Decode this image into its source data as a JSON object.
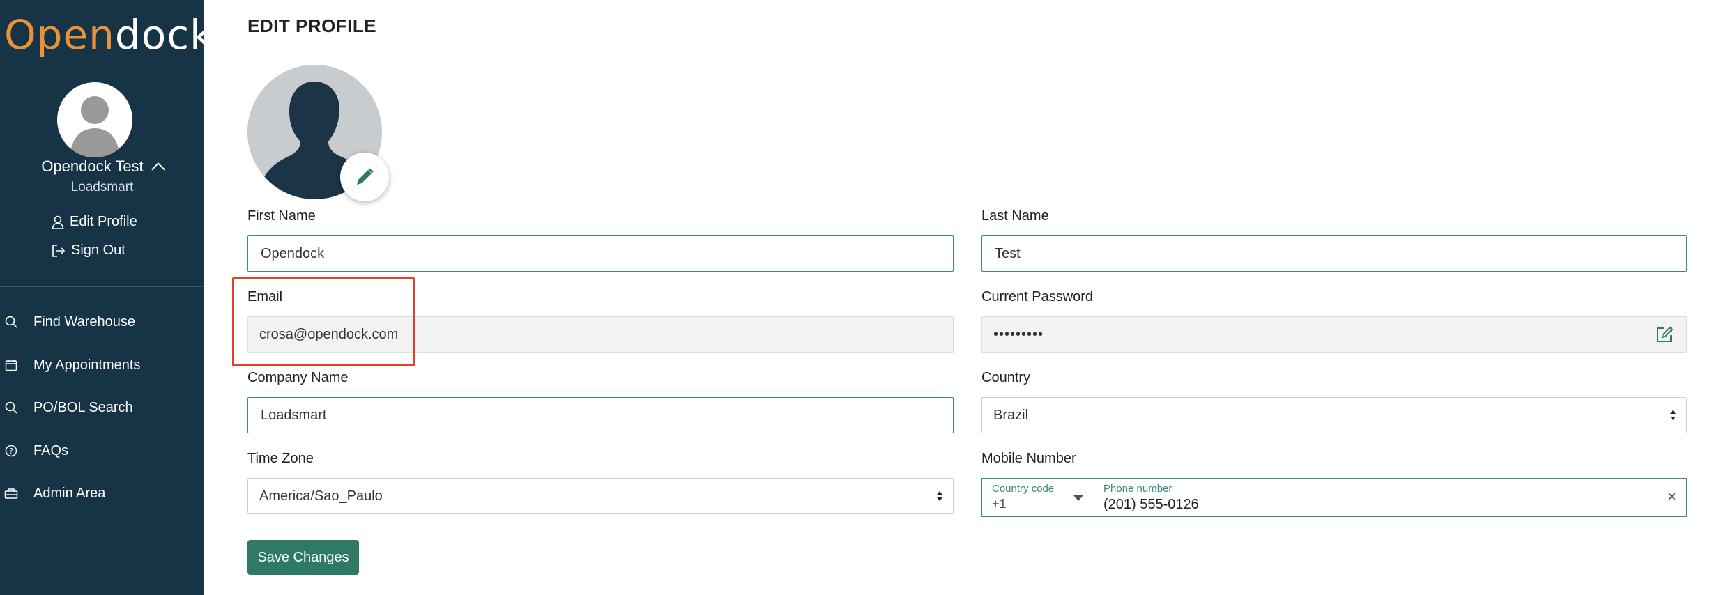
{
  "brand": {
    "part1": "Open",
    "part2": "dock",
    "reg": "®"
  },
  "sidebar": {
    "user_name": "Opendock Test",
    "org_name": "Loadsmart",
    "edit_profile": "Edit Profile",
    "sign_out": "Sign Out",
    "nav": [
      {
        "label": "Find Warehouse",
        "icon": "search-icon"
      },
      {
        "label": "My Appointments",
        "icon": "calendar-icon"
      },
      {
        "label": "PO/BOL Search",
        "icon": "search-icon"
      },
      {
        "label": "FAQs",
        "icon": "help-icon"
      },
      {
        "label": "Admin Area",
        "icon": "admin-icon"
      }
    ]
  },
  "page": {
    "title": "EDIT PROFILE"
  },
  "form": {
    "first_name": {
      "label": "First Name",
      "value": "Opendock"
    },
    "last_name": {
      "label": "Last Name",
      "value": "Test"
    },
    "email": {
      "label": "Email",
      "value": "crosa@opendock.com"
    },
    "password": {
      "label": "Current Password",
      "value": "•••••••••"
    },
    "company": {
      "label": "Company Name",
      "value": "Loadsmart"
    },
    "country": {
      "label": "Country",
      "value": "Brazil"
    },
    "timezone": {
      "label": "Time Zone",
      "value": "America/Sao_Paulo"
    },
    "mobile": {
      "label": "Mobile Number",
      "country_code_label": "Country code",
      "country_code": "+1",
      "phone_label": "Phone number",
      "phone": "(201) 555-0126",
      "clear": "×"
    },
    "save": "Save Changes"
  },
  "colors": {
    "sidebar_bg": "#173346",
    "brand_orange": "#e8923c",
    "accent_green": "#2f7a66",
    "highlight_red": "#e0412e"
  }
}
